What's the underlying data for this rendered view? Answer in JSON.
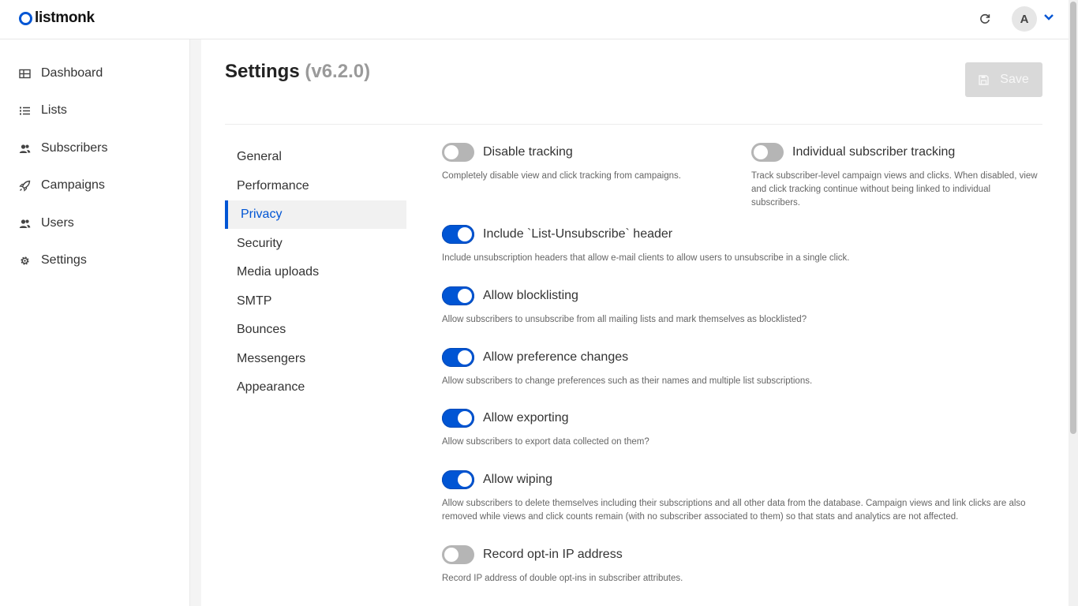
{
  "app": {
    "logo_text": "listmonk"
  },
  "header": {
    "avatar_initial": "A"
  },
  "sidebar": {
    "items": [
      {
        "label": "Dashboard",
        "icon": "dashboard-icon"
      },
      {
        "label": "Lists",
        "icon": "list-icon"
      },
      {
        "label": "Subscribers",
        "icon": "subscribers-icon"
      },
      {
        "label": "Campaigns",
        "icon": "rocket-icon"
      },
      {
        "label": "Users",
        "icon": "users-icon"
      },
      {
        "label": "Settings",
        "icon": "gear-icon"
      }
    ]
  },
  "page": {
    "title": "Settings",
    "version": "(v6.2.0)",
    "save_label": "Save"
  },
  "settings_nav": {
    "active": "Privacy",
    "items": [
      "General",
      "Performance",
      "Privacy",
      "Security",
      "Media uploads",
      "SMTP",
      "Bounces",
      "Messengers",
      "Appearance"
    ]
  },
  "privacy": {
    "settings": [
      {
        "label": "Disable tracking",
        "enabled": false,
        "description": "Completely disable view and click tracking from campaigns."
      },
      {
        "label": "Individual subscriber tracking",
        "enabled": false,
        "description": "Track subscriber-level campaign views and clicks. When disabled, view and click tracking continue without being linked to individual subscribers."
      },
      {
        "label": "Include `List-Unsubscribe` header",
        "enabled": true,
        "description": "Include unsubscription headers that allow e-mail clients to allow users to unsubscribe in a single click."
      },
      {
        "label": "Allow blocklisting",
        "enabled": true,
        "description": "Allow subscribers to unsubscribe from all mailing lists and mark themselves as blocklisted?"
      },
      {
        "label": "Allow preference changes",
        "enabled": true,
        "description": "Allow subscribers to change preferences such as their names and multiple list subscriptions."
      },
      {
        "label": "Allow exporting",
        "enabled": true,
        "description": "Allow subscribers to export data collected on them?"
      },
      {
        "label": "Allow wiping",
        "enabled": true,
        "description": "Allow subscribers to delete themselves including their subscriptions and all other data from the database. Campaign views and link clicks are also removed while views and click counts remain (with no subscriber associated to them) so that stats and analytics are not affected."
      },
      {
        "label": "Record opt-in IP address",
        "enabled": false,
        "description": "Record IP address of double opt-ins in subscriber attributes."
      }
    ]
  },
  "colors": {
    "accent": "#0055d4",
    "toggle_off": "#b5b5b5"
  }
}
